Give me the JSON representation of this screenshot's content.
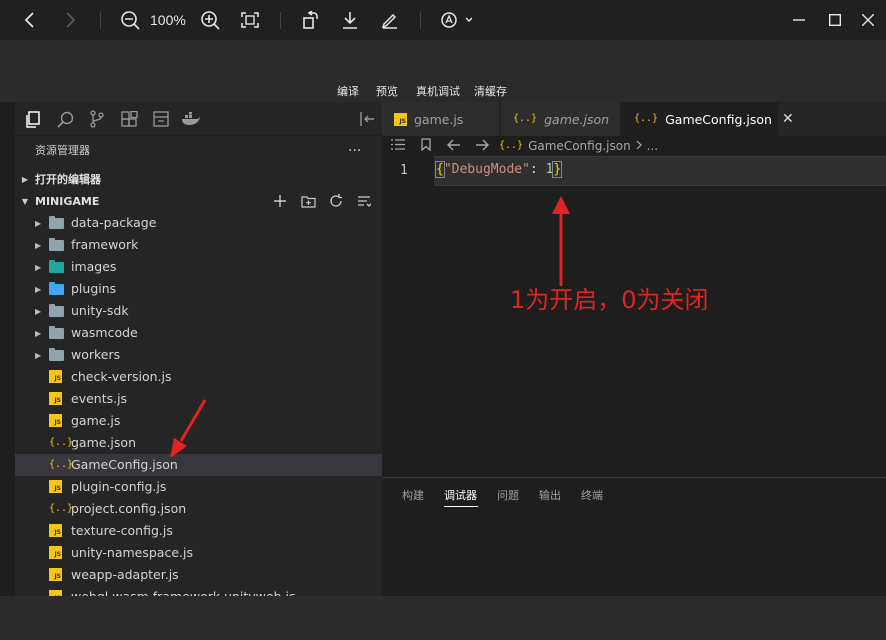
{
  "viewer": {
    "zoom": "100%",
    "icons": [
      "back-arrow-icon",
      "forward-arrow-icon",
      "zoom-out-icon",
      "zoom-in-icon",
      "fit-screen-icon",
      "rotate-icon",
      "download-icon",
      "edit-icon",
      "text-recognition-icon",
      "minimize-icon",
      "maximize-icon",
      "close-icon"
    ]
  },
  "menu": {
    "items": [
      "编译",
      "预览",
      "真机调试",
      "清缓存"
    ]
  },
  "sidebar": {
    "title": "资源管理器",
    "more": "...",
    "open_editors": "打开的编辑器",
    "project": "MINIGAME",
    "items": [
      {
        "label": "data-package",
        "kind": "folder"
      },
      {
        "label": "framework",
        "kind": "folder"
      },
      {
        "label": "images",
        "kind": "folder-green"
      },
      {
        "label": "plugins",
        "kind": "folder-blue"
      },
      {
        "label": "unity-sdk",
        "kind": "folder"
      },
      {
        "label": "wasmcode",
        "kind": "folder"
      },
      {
        "label": "workers",
        "kind": "folder"
      },
      {
        "label": "check-version.js",
        "kind": "js"
      },
      {
        "label": "events.js",
        "kind": "js"
      },
      {
        "label": "game.js",
        "kind": "js"
      },
      {
        "label": "game.json",
        "kind": "json"
      },
      {
        "label": "GameConfig.json",
        "kind": "json",
        "selected": true
      },
      {
        "label": "plugin-config.js",
        "kind": "js"
      },
      {
        "label": "project.config.json",
        "kind": "json"
      },
      {
        "label": "texture-config.js",
        "kind": "js"
      },
      {
        "label": "unity-namespace.js",
        "kind": "js"
      },
      {
        "label": "weapp-adapter.js",
        "kind": "js"
      },
      {
        "label": "webgl.wasm.framework.unityweb.js",
        "kind": "js"
      }
    ]
  },
  "editor": {
    "tabs": [
      {
        "label": "game.js",
        "kind": "js"
      },
      {
        "label": "game.json",
        "kind": "json"
      },
      {
        "label": "GameConfig.json",
        "kind": "json",
        "active": true
      }
    ],
    "close_glyph": "✕",
    "breadcrumb": [
      "GameConfig.json",
      "..."
    ],
    "line_number": "1",
    "code": {
      "open": "{",
      "key": "\"DebugMode\"",
      "colon": ": ",
      "value": "1",
      "close": "}"
    },
    "annotation": "1为开启，0为关闭"
  },
  "panel": {
    "tabs": [
      "构建",
      "调试器",
      "问题",
      "输出",
      "终端"
    ],
    "active_tab": "调试器"
  },
  "colors": {
    "annotation": "#e02424",
    "json_icon": "#f5c518",
    "selected_row": "#37373d"
  }
}
